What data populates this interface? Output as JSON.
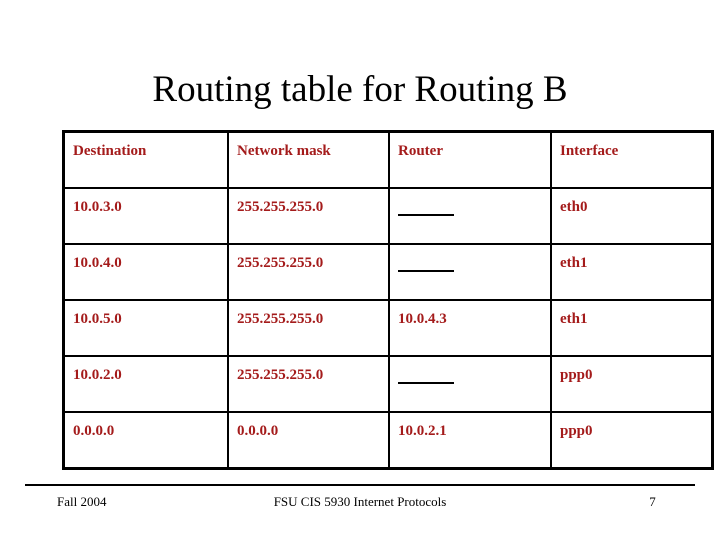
{
  "slide": {
    "title": "Routing table for Routing B",
    "accent_color": "#a41b1b",
    "text_color": "#000000",
    "background": "#ffffff"
  },
  "table": {
    "columns": [
      {
        "key": "destination",
        "label": "Destination"
      },
      {
        "key": "network_mask",
        "label": "Network mask"
      },
      {
        "key": "router",
        "label": "Router"
      },
      {
        "key": "interface",
        "label": "Interface"
      }
    ],
    "rows": [
      {
        "destination": "10.0.3.0",
        "network_mask": "255.255.255.0",
        "router": "_____",
        "router_blank": true,
        "interface": "eth0"
      },
      {
        "destination": "10.0.4.0",
        "network_mask": "255.255.255.0",
        "router": "_____",
        "router_blank": true,
        "interface": "eth1"
      },
      {
        "destination": "10.0.5.0",
        "network_mask": "255.255.255.0",
        "router": "10.0.4.3",
        "router_blank": false,
        "interface": "eth1"
      },
      {
        "destination": "10.0.2.0",
        "network_mask": "255.255.255.0",
        "router": "_____",
        "router_blank": true,
        "interface": "ppp0"
      },
      {
        "destination": "0.0.0.0",
        "network_mask": "0.0.0.0",
        "router": "10.0.2.1",
        "router_blank": false,
        "interface": "ppp0"
      }
    ]
  },
  "footer": {
    "left": "Fall 2004",
    "center": "FSU CIS 5930 Internet Protocols",
    "page_number": "7"
  }
}
